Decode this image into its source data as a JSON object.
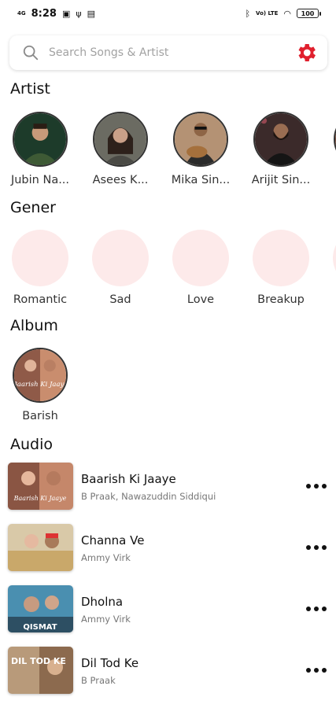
{
  "status_bar": {
    "time": "8:28",
    "network": "4G",
    "volte": "Vo) LTE",
    "battery": "100"
  },
  "search": {
    "placeholder": "Search Songs & Artist",
    "settings_color": "#e0202e"
  },
  "sections": {
    "artist": "Artist",
    "genre": "Gener",
    "album": "Album",
    "audio": "Audio"
  },
  "artists": [
    {
      "name": "Jubin Na..."
    },
    {
      "name": "Asees K..."
    },
    {
      "name": "Mika Sin..."
    },
    {
      "name": "Arijit Sin..."
    }
  ],
  "genres": [
    {
      "name": "Romantic"
    },
    {
      "name": "Sad"
    },
    {
      "name": "Love"
    },
    {
      "name": "Breakup"
    }
  ],
  "albums": [
    {
      "name": "Barish",
      "art_text": "Baarish Ki Jaaye"
    }
  ],
  "audio": [
    {
      "title": "Baarish Ki Jaaye",
      "artist": "B Praak, Nawazuddin Siddiqui",
      "art_text": "Baarish Ki Jaaye"
    },
    {
      "title": "Channa Ve",
      "artist": "Ammy Virk"
    },
    {
      "title": "Dholna",
      "artist": "Ammy Virk",
      "art_text": "QISMAT"
    },
    {
      "title": "Dil Tod Ke",
      "artist": "B Praak",
      "art_text": "DIL TOD KE"
    }
  ],
  "colors": {
    "accent": "#e0202e",
    "genre_bg": "#fdeaea"
  }
}
